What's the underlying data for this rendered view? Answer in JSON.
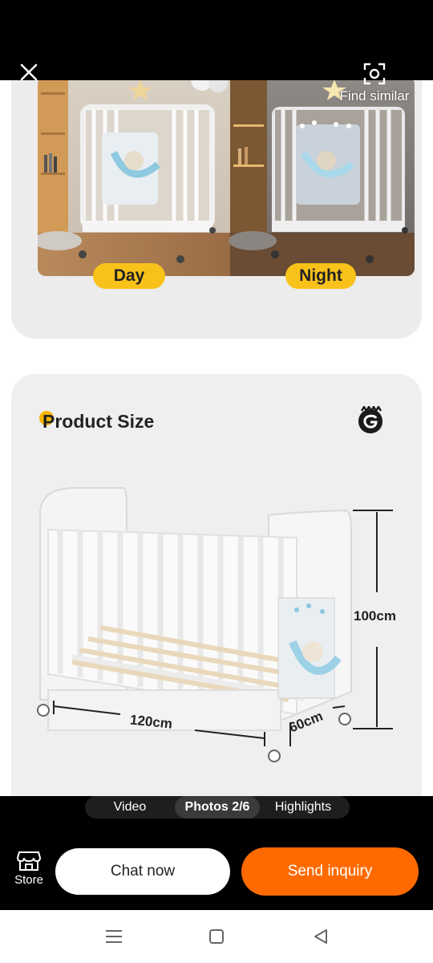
{
  "header": {
    "close_icon": "close-icon",
    "find_similar_label": "Find similar",
    "find_similar_icon": "scan-icon"
  },
  "gallery": {
    "day_label": "Day",
    "night_label": "Night",
    "product_size_title": "Product Size",
    "dimensions": {
      "height": "100cm",
      "width": "120cm",
      "depth": "60cm"
    }
  },
  "media_tabs": {
    "video": "Video",
    "photos": "Photos 2/6",
    "highlights": "Highlights",
    "active": "photos"
  },
  "actions": {
    "store_label": "Store",
    "chat_label": "Chat now",
    "inquiry_label": "Send inquiry"
  },
  "colors": {
    "accent": "#ff6a00",
    "badge": "#f9c21a"
  }
}
